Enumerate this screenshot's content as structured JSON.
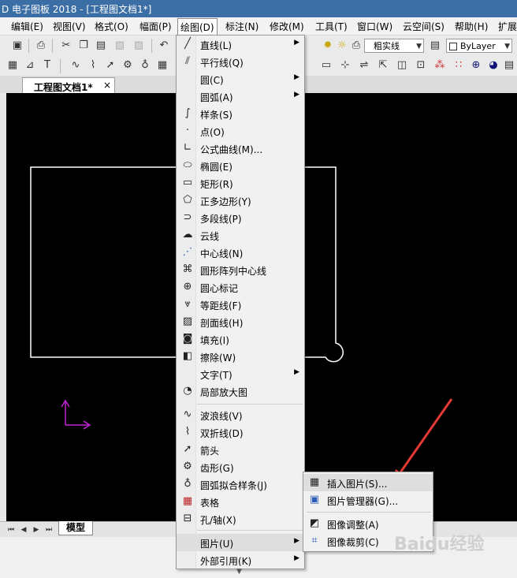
{
  "window": {
    "title": "D 电子图板 2018 - [工程图文档1*]"
  },
  "menubar": {
    "items": [
      {
        "label": "编辑(E)"
      },
      {
        "label": "视图(V)"
      },
      {
        "label": "格式(O)"
      },
      {
        "label": "幅面(P)"
      },
      {
        "label": "绘图(D)"
      },
      {
        "label": "标注(N)"
      },
      {
        "label": "修改(M)"
      },
      {
        "label": "工具(T)"
      },
      {
        "label": "窗口(W)"
      },
      {
        "label": "云空间(S)"
      },
      {
        "label": "帮助(H)"
      },
      {
        "label": "扩展"
      }
    ]
  },
  "toolbar": {
    "linetype_combo": "粗实线",
    "layer_combo": "ByLayer"
  },
  "tabs": {
    "document": "工程图文档1*",
    "close": "×",
    "model": "模型"
  },
  "draw_menu": {
    "items": [
      {
        "label": "直线(L)",
        "icon": "line-icon",
        "arrow": true
      },
      {
        "label": "平行线(Q)",
        "icon": "parallel-line-icon"
      },
      {
        "label": "圆(C)",
        "icon": "circle-icon",
        "arrow": true
      },
      {
        "label": "圆弧(A)",
        "icon": "arc-icon",
        "arrow": true
      },
      {
        "label": "样条(S)",
        "icon": "spline-icon"
      },
      {
        "label": "点(O)",
        "icon": "point-icon"
      },
      {
        "label": "公式曲线(M)...",
        "icon": "formula-curve-icon"
      },
      {
        "label": "椭圆(E)",
        "icon": "ellipse-icon"
      },
      {
        "label": "矩形(R)",
        "icon": "rectangle-icon"
      },
      {
        "label": "正多边形(Y)",
        "icon": "polygon-icon"
      },
      {
        "label": "多段线(P)",
        "icon": "polyline-icon"
      },
      {
        "label": "云线",
        "icon": "cloud-line-icon"
      },
      {
        "label": "中心线(N)",
        "icon": "centerline-icon"
      },
      {
        "label": "圆形阵列中心线",
        "icon": "circular-array-centerline-icon"
      },
      {
        "label": "圆心标记",
        "icon": "center-mark-icon"
      },
      {
        "label": "等距线(F)",
        "icon": "offset-line-icon"
      },
      {
        "label": "剖面线(H)",
        "icon": "hatch-icon"
      },
      {
        "label": "填充(I)",
        "icon": "fill-icon"
      },
      {
        "label": "擦除(W)",
        "icon": "wipeout-icon"
      },
      {
        "label": "文字(T)",
        "icon": "text-icon",
        "arrow": true
      },
      {
        "label": "局部放大图",
        "icon": "detail-view-icon"
      },
      {
        "label": "波浪线(V)",
        "icon": "wave-line-icon"
      },
      {
        "label": "双折线(D)",
        "icon": "double-break-line-icon"
      },
      {
        "label": "箭头",
        "icon": "arrow-icon"
      },
      {
        "label": "齿形(G)",
        "icon": "gear-tooth-icon"
      },
      {
        "label": "圆弧拟合样条(J)",
        "icon": "arc-fit-spline-icon"
      },
      {
        "label": "表格",
        "icon": "table-icon"
      },
      {
        "label": "孔/轴(X)",
        "icon": "hole-shaft-icon"
      },
      {
        "label": "图片(U)",
        "icon": "",
        "arrow": true
      },
      {
        "label": "外部引用(K)",
        "icon": "",
        "arrow": true
      }
    ]
  },
  "image_submenu": {
    "items": [
      {
        "label": "插入图片(S)...",
        "icon": "insert-image-icon"
      },
      {
        "label": "图片管理器(G)...",
        "icon": "image-manager-icon"
      },
      {
        "label": "图像调整(A)",
        "icon": "image-adjust-icon"
      },
      {
        "label": "图像裁剪(C)",
        "icon": "image-crop-icon"
      }
    ]
  },
  "watermark": "Baidu经验",
  "colors": {
    "canvas": "#000000",
    "drawing": "#ffffff",
    "ucs": "#c026d3",
    "annotation_arrow": "#e53935"
  }
}
